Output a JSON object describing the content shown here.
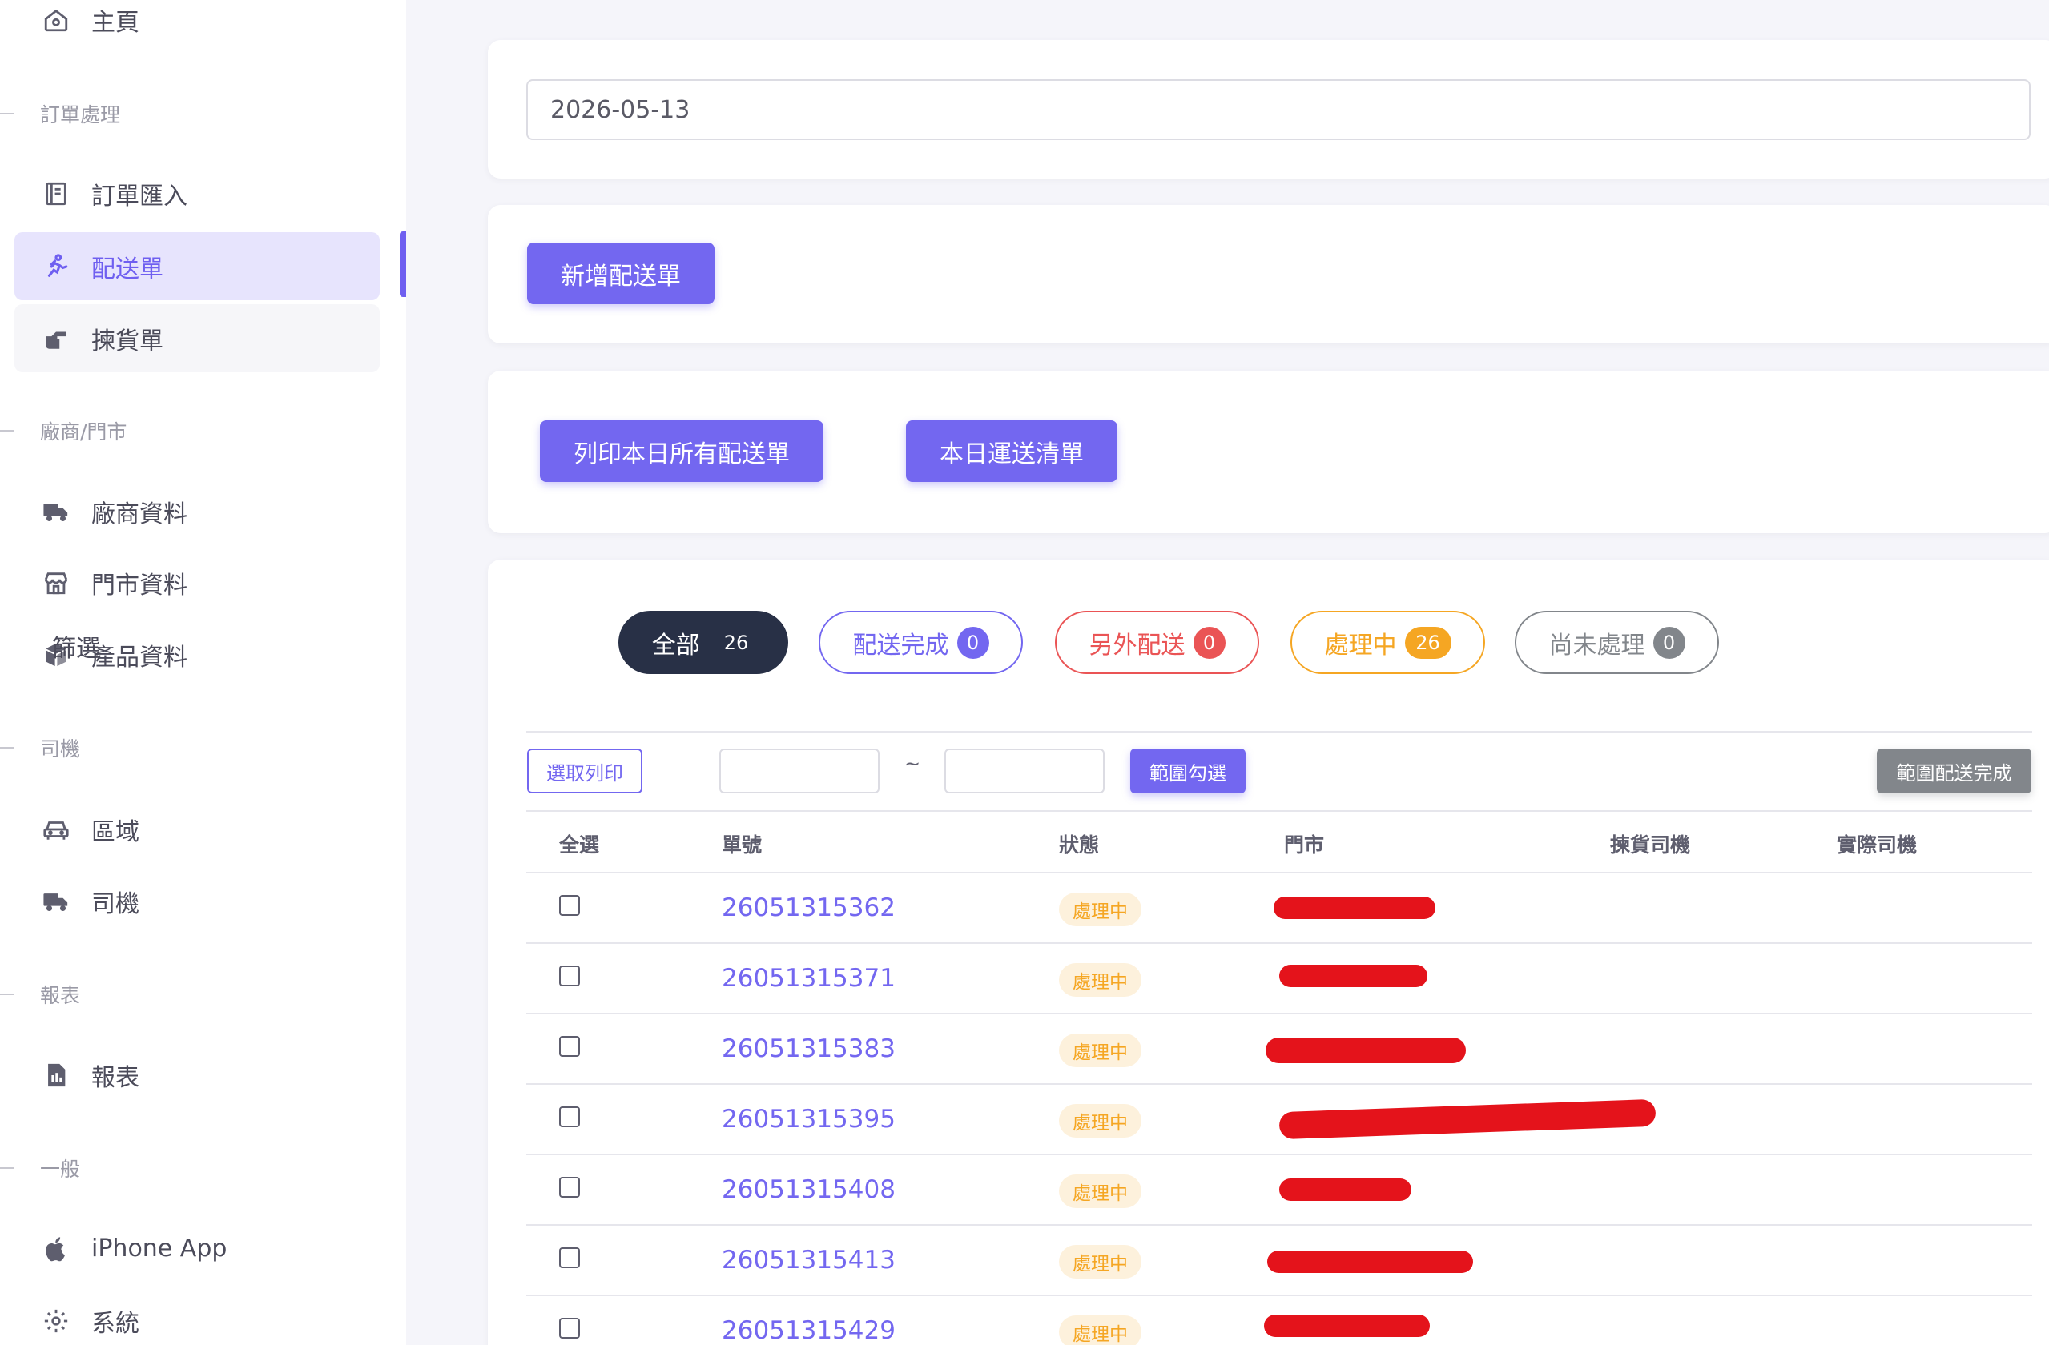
{
  "sidebar": {
    "home": "主頁",
    "sections": [
      "訂單處理",
      "廠商/門市",
      "司機",
      "報表",
      "一般"
    ],
    "items": [
      {
        "label": "訂單匯入",
        "icon": "book-icon"
      },
      {
        "label": "配送單",
        "icon": "running-person-icon"
      },
      {
        "label": "揀貨單",
        "icon": "hand-pointing-icon"
      },
      {
        "label": "廠商資料",
        "icon": "truck-icon"
      },
      {
        "label": "門市資料",
        "icon": "storefront-icon"
      },
      {
        "label": "產品資料",
        "icon": "box-icon"
      },
      {
        "label": "區域",
        "icon": "car-icon"
      },
      {
        "label": "司機",
        "icon": "truck-icon"
      },
      {
        "label": "報表",
        "icon": "report-file-icon"
      },
      {
        "label": "iPhone App",
        "icon": "apple-icon"
      },
      {
        "label": "系統",
        "icon": "gear-icon"
      }
    ]
  },
  "date_value": "2026-05-13",
  "buttons": {
    "new_delivery": "新增配送單",
    "print_all": "列印本日所有配送單",
    "today_list": "本日運送清單",
    "select_print": "選取列印",
    "range_check": "範圍勾選",
    "range_done": "範圍配送完成"
  },
  "filters": {
    "label": "篩選",
    "all": {
      "label": "全部",
      "count": "26"
    },
    "done": {
      "label": "配送完成",
      "count": "0"
    },
    "other": {
      "label": "另外配送",
      "count": "0"
    },
    "processing": {
      "label": "處理中",
      "count": "26"
    },
    "pending": {
      "label": "尚未處理",
      "count": "0"
    },
    "range_sep": "~"
  },
  "colors": {
    "accent": "#7367f0",
    "dark": "#283046",
    "danger": "#ea5455",
    "warning": "#f5a623",
    "secondary": "#82868b"
  },
  "table": {
    "headers": [
      "全選",
      "單號",
      "狀態",
      "門市",
      "揀貨司機",
      "實際司機"
    ],
    "rows": [
      {
        "order": "26051315362",
        "status": "處理中"
      },
      {
        "order": "26051315371",
        "status": "處理中"
      },
      {
        "order": "26051315383",
        "status": "處理中"
      },
      {
        "order": "26051315395",
        "status": "處理中"
      },
      {
        "order": "26051315408",
        "status": "處理中"
      },
      {
        "order": "26051315413",
        "status": "處理中"
      },
      {
        "order": "26051315429",
        "status": "處理中"
      }
    ]
  }
}
